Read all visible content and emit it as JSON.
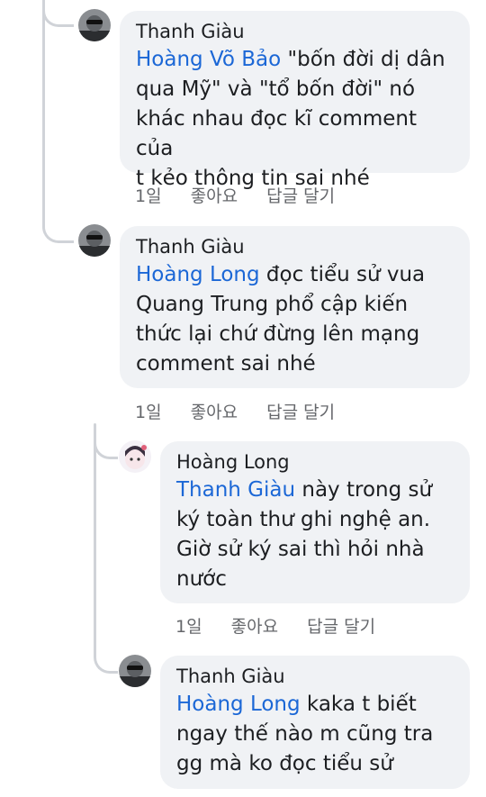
{
  "comments": [
    {
      "author": "Thanh Giàu",
      "mention": "Hoàng Võ Bảo",
      "text_lines": [
        "\"bốn đời dị dân",
        "qua Mỹ\" và \"tổ bốn đời\" nó",
        "khác nhau đọc kĩ comment của",
        "t kẻo thông tin sai nhé"
      ],
      "time": "1일",
      "like": "좋아요",
      "reply": "답글 달기"
    },
    {
      "author": "Thanh Giàu",
      "mention": "Hoàng Long",
      "text_lines": [
        "đọc tiểu sử vua",
        "Quang Trung phổ cập kiến",
        "thức lại chứ đừng lên mạng",
        "comment sai nhé"
      ],
      "time": "1일",
      "like": "좋아요",
      "reply": "답글 달기"
    },
    {
      "author": "Hoàng Long",
      "mention": "Thanh Giàu",
      "text_lines": [
        "này trong sử",
        "ký toàn thư ghi nghệ an.",
        "Giờ sử ký sai thì hỏi nhà",
        "nước"
      ],
      "time": "1일",
      "like": "좋아요",
      "reply": "답글 달기"
    },
    {
      "author": "Thanh Giàu",
      "mention": "Hoàng Long",
      "text_lines": [
        "kaka t biết",
        "ngay thế nào m cũng tra",
        "gg mà ko đọc tiểu sử"
      ]
    }
  ]
}
